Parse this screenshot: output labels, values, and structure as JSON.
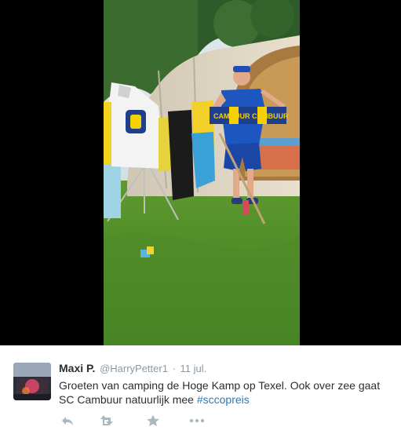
{
  "tweet": {
    "fullname": "Maxi P.",
    "username": "@HarryPetter1",
    "separator": "·",
    "time": "11 jul.",
    "text_plain": "Groeten van camping de Hoge Kamp op Texel. Ook over zee gaat SC Cambuur natuurlijk mee ",
    "hashtag": "#sccopreis"
  },
  "photo": {
    "scarf_text": "CAMBUUR CAMBUUR"
  },
  "actions": [
    {
      "name": "reply-icon"
    },
    {
      "name": "retweet-icon"
    },
    {
      "name": "favorite-icon"
    },
    {
      "name": "more-icon"
    }
  ],
  "colors": {
    "text": "#292f33",
    "muted": "#8899a6",
    "link": "#2b7bb9",
    "icon": "#aab8c2"
  }
}
